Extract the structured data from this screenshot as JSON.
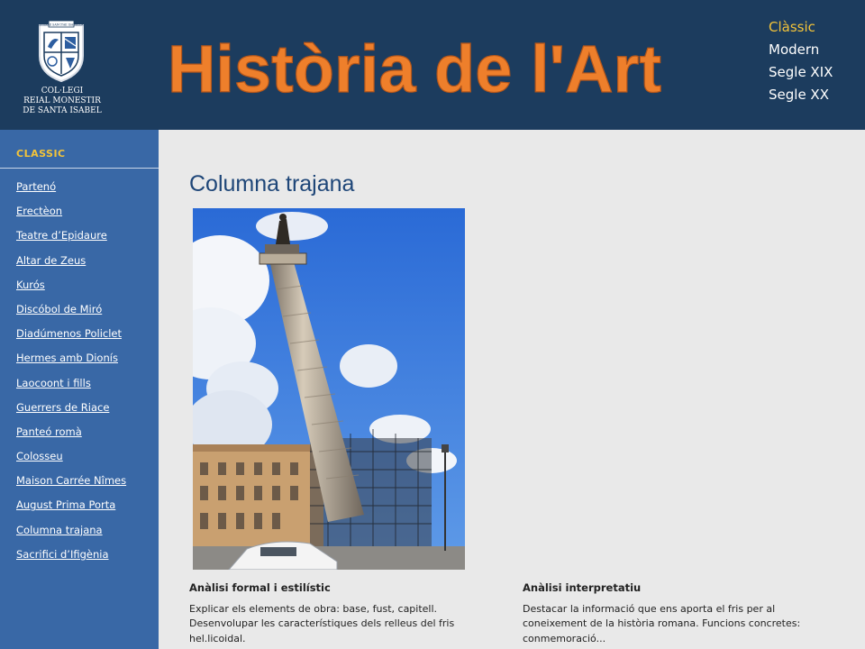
{
  "header": {
    "site_title": "Història de l'Art",
    "school_name_lines": [
      "COL·LEGI",
      "REIAL MONESTIR",
      "DE SANTA ISABEL"
    ],
    "crest_motto": "REGINAE SANCTAE ISABELLAE"
  },
  "period_nav": [
    {
      "label": "Clàssic",
      "active": true
    },
    {
      "label": "Modern",
      "active": false
    },
    {
      "label": "Segle XIX",
      "active": false
    },
    {
      "label": "Segle XX",
      "active": false
    }
  ],
  "sidebar": {
    "section_heading": "CLASSIC",
    "items": [
      {
        "label": "Partenó"
      },
      {
        "label": "Erectèon"
      },
      {
        "label": "Teatre d’Epidaure"
      },
      {
        "label": "Altar de Zeus"
      },
      {
        "label": "Kurós"
      },
      {
        "label": "Discóbol de Miró"
      },
      {
        "label": "Diadúmenos Policlet"
      },
      {
        "label": "Hermes amb Dionís"
      },
      {
        "label": "Laocoont i fills"
      },
      {
        "label": "Guerrers de Riace"
      },
      {
        "label": "Panteó romà"
      },
      {
        "label": "Colosseu"
      },
      {
        "label": "Maison Carrée Nîmes"
      },
      {
        "label": "August Prima Porta"
      },
      {
        "label": "Columna trajana"
      },
      {
        "label": "Sacrifici d’Ifigènia"
      }
    ]
  },
  "main": {
    "title": "Columna trajana",
    "formal_analysis": {
      "heading": "Anàlisi formal i estilístic",
      "body": "Explicar els elements de obra: base, fust, capitell. Desenvolupar les característiques dels relleus del fris hel.licoidal."
    },
    "interpretive_analysis": {
      "heading": "Anàlisi interpretatiu",
      "body": "Destacar la informació que ens aporta el fris per al coneixement de la història romana. Funcions concretes: conmemoració..."
    }
  },
  "colors": {
    "header_bg": "#1c3c5e",
    "sidebar_bg": "#3968a6",
    "content_bg": "#e9e9e9",
    "title_orange": "#ee7f2b",
    "active_nav": "#f2c33a",
    "page_title": "#1e4678"
  },
  "icons": [
    "school-crest-logo"
  ]
}
